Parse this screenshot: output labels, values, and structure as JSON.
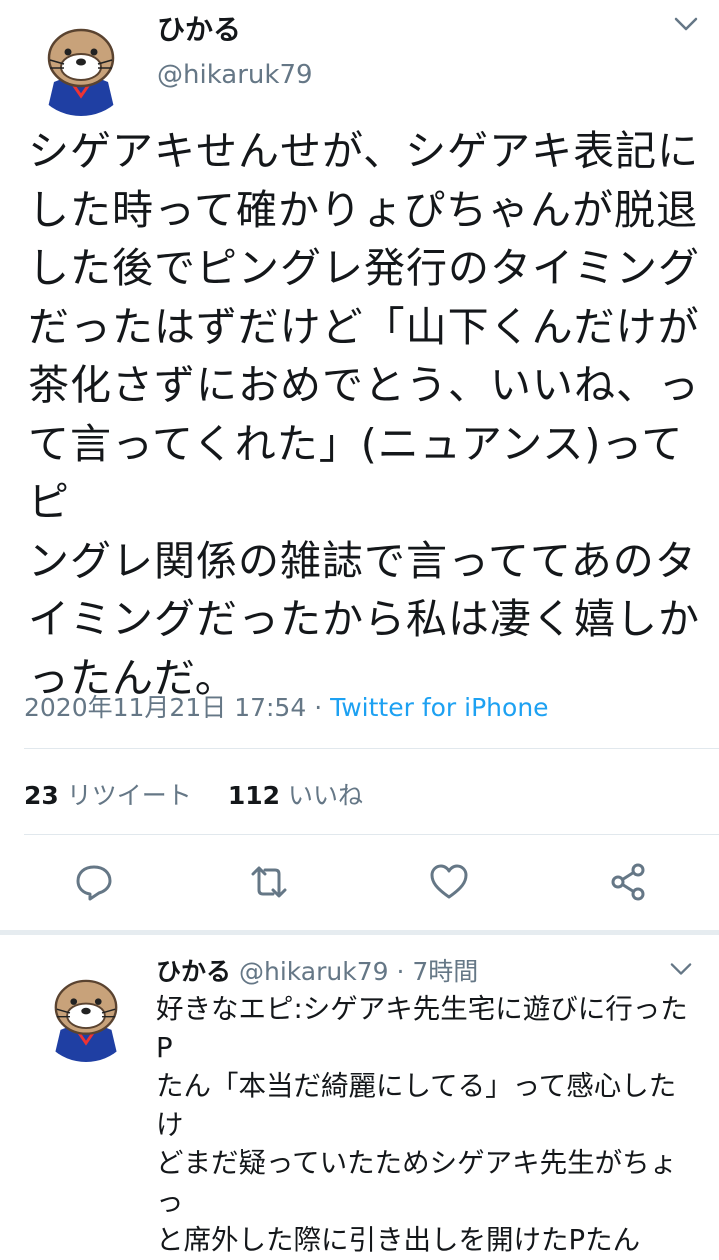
{
  "tweet": {
    "author_name": "ひかる",
    "author_handle": "@hikaruk79",
    "text": "シゲアキせんせが、シゲアキ表記に\nした時って確かりょぴちゃんが脱退\nした後でピングレ発行のタイミング\nだったはずだけど「山下くんだけが\n茶化さずにおめでとう、いいね、っ\nて言ってくれた」(ニュアンス)ってピ\nングレ関係の雑誌で言っててあのタ\nイミングだったから私は凄く嬉しか\nったんだ。",
    "timestamp": "2020年11月21日 17:54",
    "separator": " · ",
    "via": "Twitter for iPhone",
    "retweet_count": "23",
    "retweet_label": "リツイート",
    "like_count": "112",
    "like_label": "いいね"
  },
  "reply": {
    "author_name": "ひかる",
    "author_handle": "@hikaruk79",
    "time": "· 7時間",
    "text": "好きなエピ:シゲアキ先生宅に遊びに行ったP\nたん「本当だ綺麗にしてる」って感心したけ\nどまだ疑っていたためシゲアキ先生がちょっ\nと席外した際に引き出しを開けたPたん"
  },
  "icons": {
    "menu": "chevron-down-icon",
    "reply": "reply-icon",
    "retweet": "retweet-icon",
    "like": "heart-icon",
    "share": "share-icon"
  },
  "colors": {
    "text": "#14171a",
    "muted": "#657786",
    "link": "#1da1f2",
    "divider": "#e1e8ed"
  }
}
